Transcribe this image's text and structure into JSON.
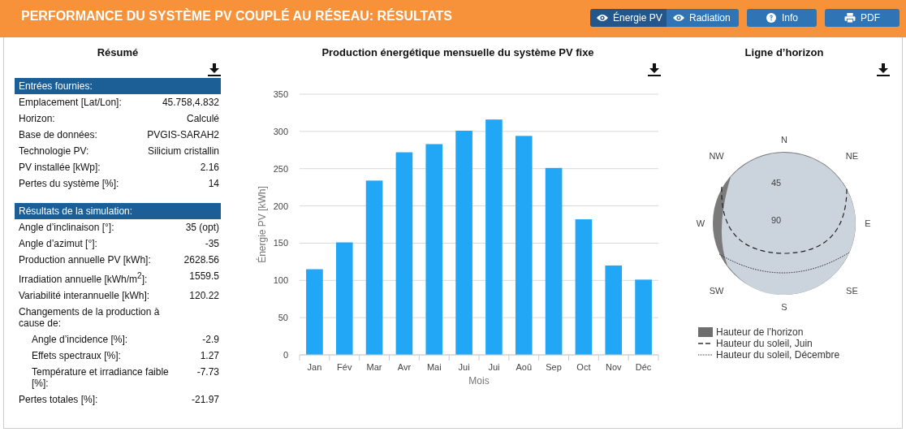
{
  "header": {
    "title": "PERFORMANCE DU SYSTÈME PV COUPLÉ AU RÉSEAU: RÉSULTATS",
    "buttons": [
      {
        "label": "Énergie PV",
        "kind": "toggle",
        "selected": true
      },
      {
        "label": "Radiation",
        "kind": "toggle",
        "selected": false
      },
      {
        "label": "Info",
        "kind": "info"
      },
      {
        "label": "PDF",
        "kind": "print"
      }
    ]
  },
  "summary": {
    "title": "Résumé",
    "sections": [
      {
        "title": "Entrées fournies:",
        "rows": [
          {
            "label": "Emplacement [Lat/Lon]:",
            "value": "45.758,4.832",
            "kind": "row"
          },
          {
            "label": "Horizon:",
            "value": "Calculé",
            "kind": "row"
          },
          {
            "label": "Base de données:",
            "value": "PVGIS-SARAH2",
            "kind": "row"
          },
          {
            "label": "Technologie PV:",
            "value": "Silicium cristallin",
            "kind": "row"
          },
          {
            "label": "PV installée [kWp]:",
            "value": "2.16",
            "kind": "row"
          },
          {
            "label": "Pertes du système [%]:",
            "value": "14",
            "kind": "row"
          }
        ]
      },
      {
        "title": "Résultats de la simulation:",
        "rows": [
          {
            "label": "Angle d’inclinaison [°]:",
            "value": "35 (opt)",
            "kind": "row"
          },
          {
            "label": "Angle d’azimut [°]:",
            "value": "-35",
            "kind": "row"
          },
          {
            "label": "Production annuelle PV [kWh]:",
            "value": "2628.56",
            "kind": "row"
          },
          {
            "label": "Irradiation annuelle [kWh/m$^{2}$]:",
            "value": "1559.5",
            "kind": "row"
          },
          {
            "label": "Variabilité interannuelle [kWh]:",
            "value": "120.22",
            "kind": "row"
          },
          {
            "label": "Changements de la production à cause de:",
            "kind": "group"
          },
          {
            "label": "Angle d’incidence [%]:",
            "value": "-2.9",
            "kind": "sub"
          },
          {
            "label": "Effets spectraux [%]:",
            "value": "1.27",
            "kind": "sub"
          },
          {
            "label": "Température et irradiance faible [%]:",
            "value": "-7.73",
            "kind": "sub"
          },
          {
            "label": "Pertes totales [%]:",
            "value": "-21.97",
            "kind": "row"
          }
        ]
      }
    ]
  },
  "production": {
    "title": "Production énergétique mensuelle du système PV fixe",
    "chart_data": {
      "type": "bar",
      "xlabel": "Mois",
      "ylabel": "Énergie PV [kWh]",
      "categories": [
        "Jan",
        "Fév",
        "Mar",
        "Avr",
        "Mai",
        "Jui",
        "Jui",
        "Aoû",
        "Sep",
        "Oct",
        "Nov",
        "Déc"
      ],
      "grid": true,
      "series": [
        {
          "color": "#22a7f7",
          "values": [
            115,
            151,
            234,
            272,
            283,
            301,
            316,
            294,
            251,
            182,
            120,
            101
          ]
        }
      ],
      "ylim": [
        0,
        350
      ],
      "yticks": [
        0,
        50,
        100,
        150,
        200,
        250,
        300,
        350
      ]
    }
  },
  "horizon": {
    "title": "Ligne d’horizon",
    "directions": [
      "N",
      "NE",
      "E",
      "SE",
      "S",
      "SW",
      "W",
      "NW"
    ],
    "rings": [
      "45",
      "90"
    ],
    "legend": [
      {
        "label": "Hauteur de l’horizon",
        "kind": "area"
      },
      {
        "label": "Hauteur du soleil, Juin",
        "kind": "dashed"
      },
      {
        "label": "Hauteur du soleil, Décembre",
        "kind": "dotted"
      }
    ]
  }
}
